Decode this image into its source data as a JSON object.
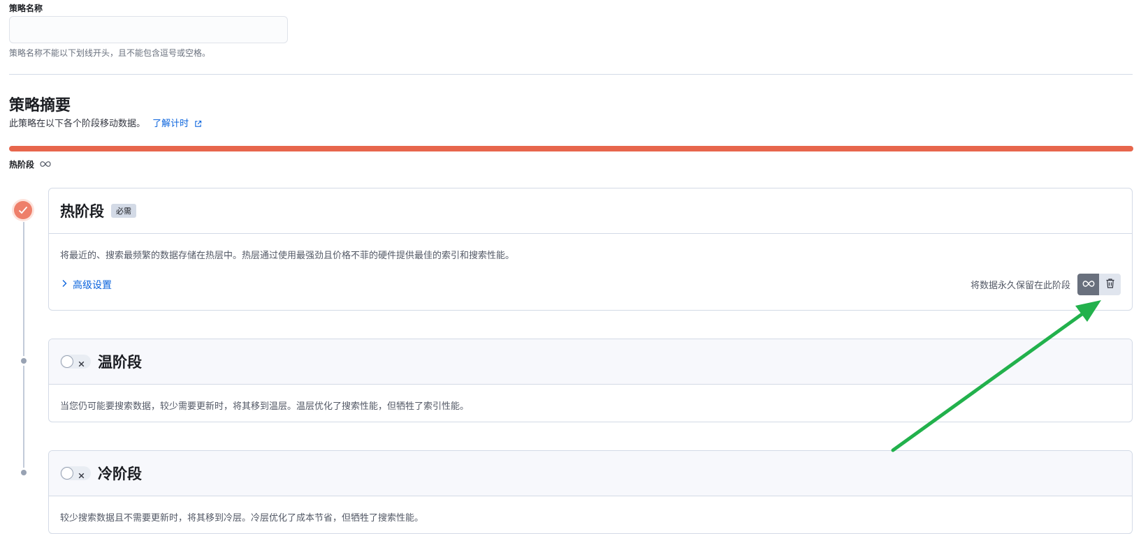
{
  "policy_name": {
    "label": "策略名称",
    "value": "",
    "help": "策略名称不能以下划线开头，且不能包含逗号或空格。"
  },
  "summary": {
    "title": "策略摘要",
    "description": "此策略在以下各个阶段移动数据。",
    "link": "了解计时",
    "bar_label": "热阶段",
    "bar_color": "#e7664c"
  },
  "phases": {
    "hot": {
      "title": "热阶段",
      "badge": "必需",
      "description": "将最近的、搜索最频繁的数据存储在热层中。热层通过使用最强劲且价格不菲的硬件提供最佳的索引和搜索性能。",
      "advanced": "高级设置",
      "retain_label": "将数据永久保留在此阶段",
      "accent": "#ee7f6a"
    },
    "warm": {
      "title": "温阶段",
      "enabled": false,
      "description": "当您仍可能要搜索数据，较少需要更新时，将其移到温层。温层优化了搜索性能，但牺牲了索引性能。"
    },
    "cold": {
      "title": "冷阶段",
      "enabled": false,
      "description": "较少搜索数据且不需要更新时，将其移到冷层。冷层优化了成本节省，但牺牲了搜索性能。"
    }
  },
  "icons": {
    "external_link": "external-link-icon",
    "infinity": "infinity-icon",
    "trash": "trash-icon",
    "check": "check-icon",
    "chevron": "chevron-right-icon",
    "toggle_off": "close-icon"
  },
  "annotation_color": "#22b14c"
}
